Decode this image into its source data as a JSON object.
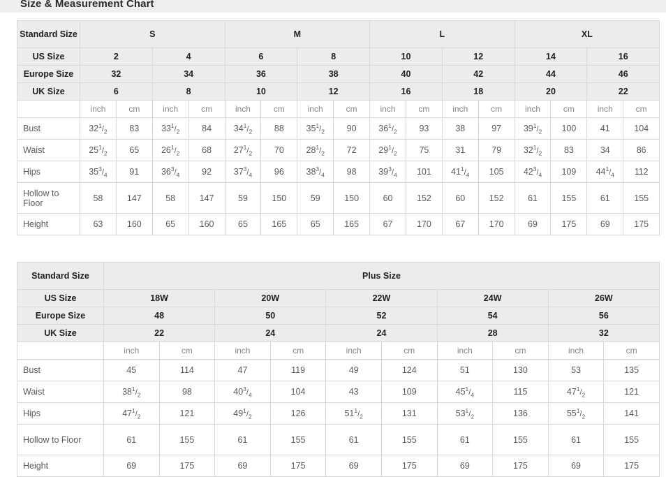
{
  "header": {
    "title": "Size & Measurement Chart",
    "background": "#efefef"
  },
  "colors": {
    "header_cell_bg": "#ececec",
    "cell_text": "#5a5a5a",
    "header_text": "#1f1f1f",
    "border": "#d8d8d8",
    "table_border": "#bcbcbc"
  },
  "standard_table": {
    "name": "Standard Size Chart",
    "row_labels": {
      "standard_size": "Standard Size",
      "us_size": "US Size",
      "europe_size": "Europe Size",
      "uk_size": "UK Size",
      "blank": ""
    },
    "size_groups": [
      {
        "label": "S",
        "span": 4
      },
      {
        "label": "M",
        "span": 4
      },
      {
        "label": "L",
        "span": 4
      },
      {
        "label": "XL",
        "span": 4
      }
    ],
    "us_size": [
      "2",
      "4",
      "6",
      "8",
      "10",
      "12",
      "14",
      "16"
    ],
    "europe_size": [
      "32",
      "34",
      "36",
      "38",
      "40",
      "42",
      "44",
      "46"
    ],
    "uk_size": [
      "6",
      "8",
      "10",
      "12",
      "16",
      "18",
      "20",
      "22"
    ],
    "units": [
      "inch",
      "cm",
      "inch",
      "cm",
      "inch",
      "cm",
      "inch",
      "cm",
      "inch",
      "cm",
      "inch",
      "cm",
      "inch",
      "cm",
      "inch",
      "cm"
    ],
    "measurements": [
      {
        "label": "Bust",
        "tall": false,
        "values": [
          {
            "w": "32",
            "n": "1",
            "d": "2"
          },
          {
            "w": "83"
          },
          {
            "w": "33",
            "n": "1",
            "d": "2"
          },
          {
            "w": "84"
          },
          {
            "w": "34",
            "n": "1",
            "d": "2"
          },
          {
            "w": "88"
          },
          {
            "w": "35",
            "n": "1",
            "d": "2"
          },
          {
            "w": "90"
          },
          {
            "w": "36",
            "n": "1",
            "d": "2"
          },
          {
            "w": "93"
          },
          {
            "w": "38"
          },
          {
            "w": "97"
          },
          {
            "w": "39",
            "n": "1",
            "d": "2"
          },
          {
            "w": "100"
          },
          {
            "w": "41"
          },
          {
            "w": "104"
          }
        ]
      },
      {
        "label": "Waist",
        "tall": false,
        "values": [
          {
            "w": "25",
            "n": "1",
            "d": "2"
          },
          {
            "w": "65"
          },
          {
            "w": "26",
            "n": "1",
            "d": "2"
          },
          {
            "w": "68"
          },
          {
            "w": "27",
            "n": "1",
            "d": "2"
          },
          {
            "w": "70"
          },
          {
            "w": "28",
            "n": "1",
            "d": "2"
          },
          {
            "w": "72"
          },
          {
            "w": "29",
            "n": "1",
            "d": "2"
          },
          {
            "w": "75"
          },
          {
            "w": "31"
          },
          {
            "w": "79"
          },
          {
            "w": "32",
            "n": "1",
            "d": "2"
          },
          {
            "w": "83"
          },
          {
            "w": "34"
          },
          {
            "w": "86"
          }
        ]
      },
      {
        "label": "Hips",
        "tall": false,
        "values": [
          {
            "w": "35",
            "n": "3",
            "d": "4"
          },
          {
            "w": "91"
          },
          {
            "w": "36",
            "n": "3",
            "d": "4"
          },
          {
            "w": "92"
          },
          {
            "w": "37",
            "n": "3",
            "d": "4"
          },
          {
            "w": "96"
          },
          {
            "w": "38",
            "n": "3",
            "d": "4"
          },
          {
            "w": "98"
          },
          {
            "w": "39",
            "n": "3",
            "d": "4"
          },
          {
            "w": "101"
          },
          {
            "w": "41",
            "n": "1",
            "d": "4"
          },
          {
            "w": "105"
          },
          {
            "w": "42",
            "n": "3",
            "d": "4"
          },
          {
            "w": "109"
          },
          {
            "w": "44",
            "n": "1",
            "d": "4"
          },
          {
            "w": "112"
          }
        ]
      },
      {
        "label": "Hollow to Floor",
        "tall": true,
        "values": [
          {
            "w": "58"
          },
          {
            "w": "147"
          },
          {
            "w": "58"
          },
          {
            "w": "147"
          },
          {
            "w": "59"
          },
          {
            "w": "150"
          },
          {
            "w": "59"
          },
          {
            "w": "150"
          },
          {
            "w": "60"
          },
          {
            "w": "152"
          },
          {
            "w": "60"
          },
          {
            "w": "152"
          },
          {
            "w": "61"
          },
          {
            "w": "155"
          },
          {
            "w": "61"
          },
          {
            "w": "155"
          }
        ]
      },
      {
        "label": "Height",
        "tall": false,
        "values": [
          {
            "w": "63"
          },
          {
            "w": "160"
          },
          {
            "w": "65"
          },
          {
            "w": "160"
          },
          {
            "w": "65"
          },
          {
            "w": "165"
          },
          {
            "w": "65"
          },
          {
            "w": "165"
          },
          {
            "w": "67"
          },
          {
            "w": "170"
          },
          {
            "w": "67"
          },
          {
            "w": "170"
          },
          {
            "w": "69"
          },
          {
            "w": "175"
          },
          {
            "w": "69"
          },
          {
            "w": "175"
          }
        ]
      }
    ]
  },
  "plus_table": {
    "name": "Plus Size Chart",
    "row_labels": {
      "standard_size": "Standard Size",
      "us_size": "US Size",
      "europe_size": "Europe Size",
      "uk_size": "UK Size",
      "blank": ""
    },
    "group_label": "Plus Size",
    "us_size": [
      "18W",
      "20W",
      "22W",
      "24W",
      "26W"
    ],
    "europe_size": [
      "48",
      "50",
      "52",
      "54",
      "56"
    ],
    "uk_size": [
      "22",
      "24",
      "24",
      "28",
      "32"
    ],
    "units": [
      "inch",
      "cm",
      "inch",
      "cm",
      "inch",
      "cm",
      "inch",
      "cm",
      "inch",
      "cm"
    ],
    "measurements": [
      {
        "label": "Bust",
        "tall": false,
        "values": [
          {
            "w": "45"
          },
          {
            "w": "114"
          },
          {
            "w": "47"
          },
          {
            "w": "119"
          },
          {
            "w": "49"
          },
          {
            "w": "124"
          },
          {
            "w": "51"
          },
          {
            "w": "130"
          },
          {
            "w": "53"
          },
          {
            "w": "135"
          }
        ]
      },
      {
        "label": "Waist",
        "tall": false,
        "values": [
          {
            "w": "38",
            "n": "1",
            "d": "2"
          },
          {
            "w": "98"
          },
          {
            "w": "40",
            "n": "3",
            "d": "4"
          },
          {
            "w": "104"
          },
          {
            "w": "43"
          },
          {
            "w": "109"
          },
          {
            "w": "45",
            "n": "1",
            "d": "4"
          },
          {
            "w": "115"
          },
          {
            "w": "47",
            "n": "1",
            "d": "2"
          },
          {
            "w": "121"
          }
        ]
      },
      {
        "label": "Hips",
        "tall": false,
        "values": [
          {
            "w": "47",
            "n": "1",
            "d": "2"
          },
          {
            "w": "121"
          },
          {
            "w": "49",
            "n": "1",
            "d": "2"
          },
          {
            "w": "126"
          },
          {
            "w": "51",
            "n": "1",
            "d": "2"
          },
          {
            "w": "131"
          },
          {
            "w": "53",
            "n": "1",
            "d": "2"
          },
          {
            "w": "136"
          },
          {
            "w": "55",
            "n": "1",
            "d": "2"
          },
          {
            "w": "141"
          }
        ]
      },
      {
        "label": "Hollow to Floor",
        "tall": true,
        "values": [
          {
            "w": "61"
          },
          {
            "w": "155"
          },
          {
            "w": "61"
          },
          {
            "w": "155"
          },
          {
            "w": "61"
          },
          {
            "w": "155"
          },
          {
            "w": "61"
          },
          {
            "w": "155"
          },
          {
            "w": "61"
          },
          {
            "w": "155"
          }
        ]
      },
      {
        "label": "Height",
        "tall": false,
        "values": [
          {
            "w": "69"
          },
          {
            "w": "175"
          },
          {
            "w": "69"
          },
          {
            "w": "175"
          },
          {
            "w": "69"
          },
          {
            "w": "175"
          },
          {
            "w": "69"
          },
          {
            "w": "175"
          },
          {
            "w": "69"
          },
          {
            "w": "175"
          }
        ]
      }
    ]
  }
}
